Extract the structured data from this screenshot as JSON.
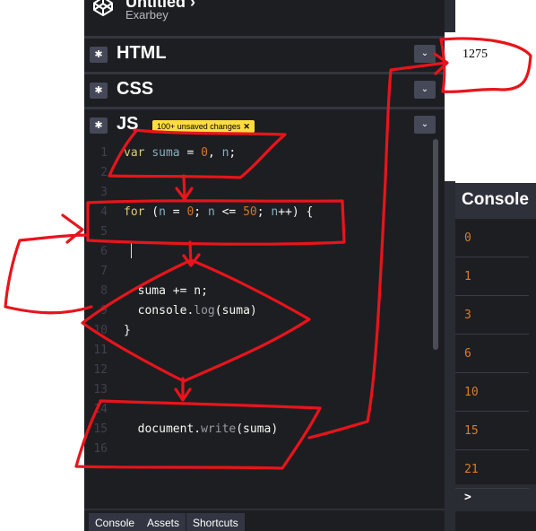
{
  "header": {
    "pen_title": "Untitled",
    "pen_title_suffix": "›",
    "author": "Exarbey"
  },
  "panels": {
    "html": {
      "label": "HTML"
    },
    "css": {
      "label": "CSS"
    },
    "js": {
      "label": "JS",
      "badge": "100+ unsaved changes",
      "badge_close": "✕"
    },
    "gear_glyph": "✱",
    "collapse_glyph": "⌄"
  },
  "code_lines": [
    {
      "n": "1",
      "tokens": [
        [
          "kw",
          "var "
        ],
        [
          "vr",
          "suma"
        ],
        [
          "pl",
          " = "
        ],
        [
          "num",
          "0"
        ],
        [
          "pl",
          ", "
        ],
        [
          "vr",
          "n"
        ],
        [
          "pl",
          ";"
        ]
      ]
    },
    {
      "n": "2",
      "tokens": []
    },
    {
      "n": "3",
      "tokens": []
    },
    {
      "n": "4",
      "tokens": [
        [
          "kw",
          "for"
        ],
        [
          "pl",
          " ("
        ],
        [
          "vr",
          "n"
        ],
        [
          "pl",
          " = "
        ],
        [
          "num",
          "0"
        ],
        [
          "pl",
          "; "
        ],
        [
          "vr",
          "n"
        ],
        [
          "pl",
          " <= "
        ],
        [
          "num",
          "50"
        ],
        [
          "pl",
          "; "
        ],
        [
          "vr",
          "n"
        ],
        [
          "pl",
          "++) {"
        ]
      ]
    },
    {
      "n": "5",
      "tokens": []
    },
    {
      "n": "6",
      "tokens": []
    },
    {
      "n": "7",
      "tokens": []
    },
    {
      "n": "8",
      "tokens": [
        [
          "pl",
          "  suma += n;"
        ]
      ]
    },
    {
      "n": "9",
      "tokens": [
        [
          "pl",
          "  console."
        ],
        [
          "fn",
          "log"
        ],
        [
          "pl",
          "(suma)"
        ]
      ]
    },
    {
      "n": "10",
      "tokens": [
        [
          "pl",
          "}"
        ]
      ]
    },
    {
      "n": "11",
      "tokens": []
    },
    {
      "n": "12",
      "tokens": []
    },
    {
      "n": "13",
      "tokens": []
    },
    {
      "n": "14",
      "tokens": []
    },
    {
      "n": "15",
      "tokens": [
        [
          "pl",
          "  document."
        ],
        [
          "fn",
          "write"
        ],
        [
          "pl",
          "(suma)"
        ]
      ]
    },
    {
      "n": "16",
      "tokens": []
    }
  ],
  "output": {
    "text": "1275"
  },
  "console": {
    "title": "Console",
    "lines": [
      "0",
      "1",
      "3",
      "6",
      "10",
      "15",
      "21"
    ],
    "prompt": ">"
  },
  "bottom_tabs": [
    "Console",
    "Assets",
    "Shortcuts"
  ],
  "colors": {
    "editor_bg": "#1d1e22",
    "keyword": "#ddca7e",
    "variable": "#88afbf",
    "number": "#d0782a",
    "console_value": "#d87c2e",
    "badge": "#ffdd40",
    "annotation_red": "#e8141b"
  },
  "icons": {
    "logo": "codepen-cube-icon",
    "settings": "gear-icon",
    "collapse": "chevron-down-icon",
    "close": "close-icon"
  }
}
